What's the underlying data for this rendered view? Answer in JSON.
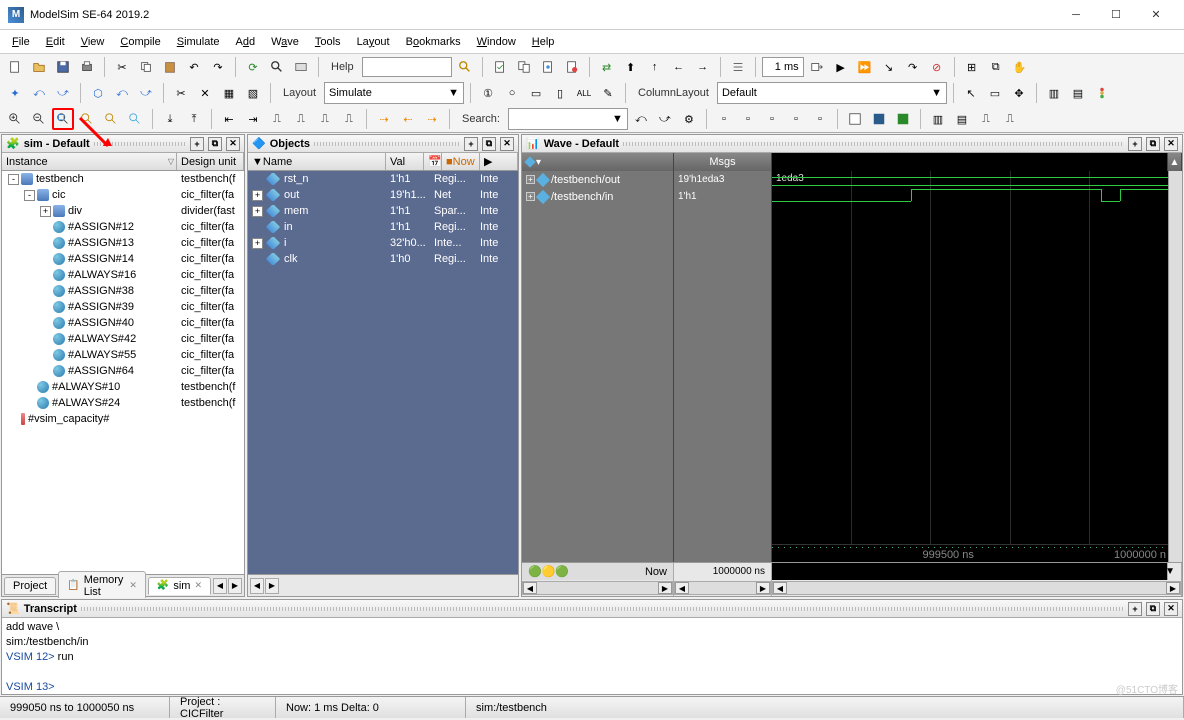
{
  "window": {
    "title": "ModelSim SE-64 2019.2"
  },
  "menus": [
    "File",
    "Edit",
    "View",
    "Compile",
    "Simulate",
    "Add",
    "Wave",
    "Tools",
    "Layout",
    "Bookmarks",
    "Window",
    "Help"
  ],
  "toolbar": {
    "help_label": "Help",
    "time_value": "1 ms",
    "layout_label": "Layout",
    "layout_value": "Simulate",
    "column_layout_label": "ColumnLayout",
    "column_layout_value": "Default",
    "search_label": "Search:"
  },
  "sim_panel": {
    "title": "sim - Default",
    "columns": [
      "Instance",
      "Design unit"
    ],
    "tree": [
      {
        "indent": 0,
        "exp": "-",
        "icon": "sq",
        "name": "testbench",
        "du": "testbench(f"
      },
      {
        "indent": 1,
        "exp": "-",
        "icon": "sq",
        "name": "cic",
        "du": "cic_filter(fa"
      },
      {
        "indent": 2,
        "exp": "+",
        "icon": "sq",
        "name": "div",
        "du": "divider(fast"
      },
      {
        "indent": 2,
        "exp": "",
        "icon": "ball",
        "name": "#ASSIGN#12",
        "du": "cic_filter(fa"
      },
      {
        "indent": 2,
        "exp": "",
        "icon": "ball",
        "name": "#ASSIGN#13",
        "du": "cic_filter(fa"
      },
      {
        "indent": 2,
        "exp": "",
        "icon": "ball",
        "name": "#ASSIGN#14",
        "du": "cic_filter(fa"
      },
      {
        "indent": 2,
        "exp": "",
        "icon": "ball",
        "name": "#ALWAYS#16",
        "du": "cic_filter(fa"
      },
      {
        "indent": 2,
        "exp": "",
        "icon": "ball",
        "name": "#ASSIGN#38",
        "du": "cic_filter(fa"
      },
      {
        "indent": 2,
        "exp": "",
        "icon": "ball",
        "name": "#ASSIGN#39",
        "du": "cic_filter(fa"
      },
      {
        "indent": 2,
        "exp": "",
        "icon": "ball",
        "name": "#ASSIGN#40",
        "du": "cic_filter(fa"
      },
      {
        "indent": 2,
        "exp": "",
        "icon": "ball",
        "name": "#ALWAYS#42",
        "du": "cic_filter(fa"
      },
      {
        "indent": 2,
        "exp": "",
        "icon": "ball",
        "name": "#ALWAYS#55",
        "du": "cic_filter(fa"
      },
      {
        "indent": 2,
        "exp": "",
        "icon": "ball",
        "name": "#ASSIGN#64",
        "du": "cic_filter(fa"
      },
      {
        "indent": 1,
        "exp": "",
        "icon": "ball",
        "name": "#ALWAYS#10",
        "du": "testbench(f"
      },
      {
        "indent": 1,
        "exp": "",
        "icon": "ball",
        "name": "#ALWAYS#24",
        "du": "testbench(f"
      },
      {
        "indent": 0,
        "exp": "",
        "icon": "bar",
        "name": "#vsim_capacity#",
        "du": ""
      }
    ],
    "tabs": [
      "Project",
      "Memory List",
      "sim"
    ]
  },
  "objects_panel": {
    "title": "Objects",
    "columns": [
      "Name",
      "Val",
      "",
      "Now",
      ""
    ],
    "rows": [
      {
        "exp": "",
        "name": "rst_n",
        "val": "1'h1",
        "kind": "Regi...",
        "type": "Inte"
      },
      {
        "exp": "+",
        "name": "out",
        "val": "19'h1...",
        "kind": "Net",
        "type": "Inte"
      },
      {
        "exp": "+",
        "name": "mem",
        "val": "1'h1",
        "kind": "Spar...",
        "type": "Inte"
      },
      {
        "exp": "",
        "name": "in",
        "val": "1'h1",
        "kind": "Regi...",
        "type": "Inte"
      },
      {
        "exp": "+",
        "name": "i",
        "val": "32'h0...",
        "kind": "Inte...",
        "type": "Inte"
      },
      {
        "exp": "",
        "name": "clk",
        "val": "1'h0",
        "kind": "Regi...",
        "type": "Inte"
      }
    ]
  },
  "wave_panel": {
    "title": "Wave - Default",
    "msgs_label": "Msgs",
    "signals": [
      {
        "path": "/testbench/out",
        "value": "19'h1eda3",
        "display": "1eda3"
      },
      {
        "path": "/testbench/in",
        "value": "1'h1",
        "display": ""
      }
    ],
    "now_label": "Now",
    "now_value": "1000000 ns",
    "ruler_ticks": [
      "999500 ns",
      "1000000 n"
    ]
  },
  "transcript": {
    "title": "Transcript",
    "lines": [
      {
        "prompt": "",
        "text": "add wave  \\"
      },
      {
        "prompt": "",
        "text": "sim:/testbench/in"
      },
      {
        "prompt": "VSIM 12> ",
        "text": "run"
      },
      {
        "prompt": "",
        "text": ""
      },
      {
        "prompt": "VSIM 13> ",
        "text": ""
      }
    ]
  },
  "statusbar": {
    "time_range": "999050 ns to 1000050 ns",
    "project": "Project : CICFilter",
    "now": "Now: 1 ms   Delta: 0",
    "context": "sim:/testbench"
  },
  "watermark": "@51CTO博客"
}
